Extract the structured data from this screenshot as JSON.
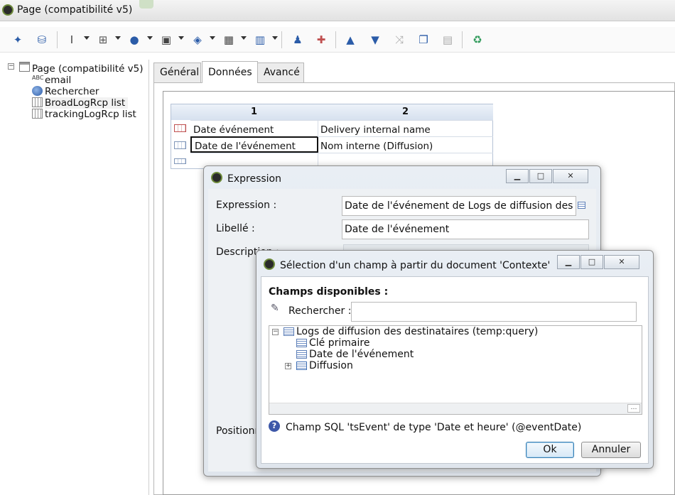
{
  "window": {
    "title": "Page (compatibilité v5)"
  },
  "toolbar": {
    "icons": [
      "wand-icon",
      "database-refresh-icon",
      "text-cursor-icon",
      "formula-icon",
      "globe-icon",
      "window-icon",
      "layers-icon",
      "table-icon",
      "columns-icon",
      "user-icon",
      "add-shape-icon",
      "arrow-up-icon",
      "arrow-down-icon",
      "shuffle-icon",
      "copy-icon",
      "paste-icon",
      "recycle-icon"
    ]
  },
  "tree": {
    "root": "Page (compatibilité v5)",
    "items": [
      {
        "label": "email",
        "icon": "text-abc-icon",
        "badge": "ABC"
      },
      {
        "label": "Rechercher",
        "icon": "search-globe-icon"
      },
      {
        "label": "BroadLogRcp list",
        "icon": "grid-icon"
      },
      {
        "label": "trackingLogRcp list",
        "icon": "grid-icon"
      }
    ]
  },
  "tabs": [
    {
      "label": "Général",
      "active": false
    },
    {
      "label": "Données",
      "active": true
    },
    {
      "label": "Avancé",
      "active": false
    }
  ],
  "grid": {
    "columns": [
      "1",
      "2"
    ],
    "rows": [
      [
        "Date événement",
        "Delivery internal name"
      ],
      [
        "Date de l'événement",
        "Nom interne (Diffusion)"
      ],
      [
        "",
        ""
      ]
    ]
  },
  "expression_dialog": {
    "title": "Expression",
    "expression_label": "Expression :",
    "expression_value": "Date de l'événement de Logs de diffusion des de",
    "label_label": "Libellé :",
    "label_value": "Date de l'événement",
    "description_label": "Description :",
    "position_label": "Positionn"
  },
  "selection_dialog": {
    "title": "Sélection d'un champ à partir du document 'Contexte'",
    "section_title": "Champs disponibles :",
    "search_label": "Rechercher :",
    "search_value": "",
    "tree_root": "Logs de diffusion des destinataires (temp:query)",
    "tree_items": [
      "Clé primaire",
      "Date de l'événement",
      "Diffusion"
    ],
    "info_text": "Champ SQL 'tsEvent' de type 'Date et heure' (@eventDate)",
    "ok_label": "Ok",
    "cancel_label": "Annuler"
  },
  "colors": {
    "accent": "#3c7fb1",
    "grid_header": "#d7e1ef",
    "dialog_bg": "#e4e9ef"
  }
}
